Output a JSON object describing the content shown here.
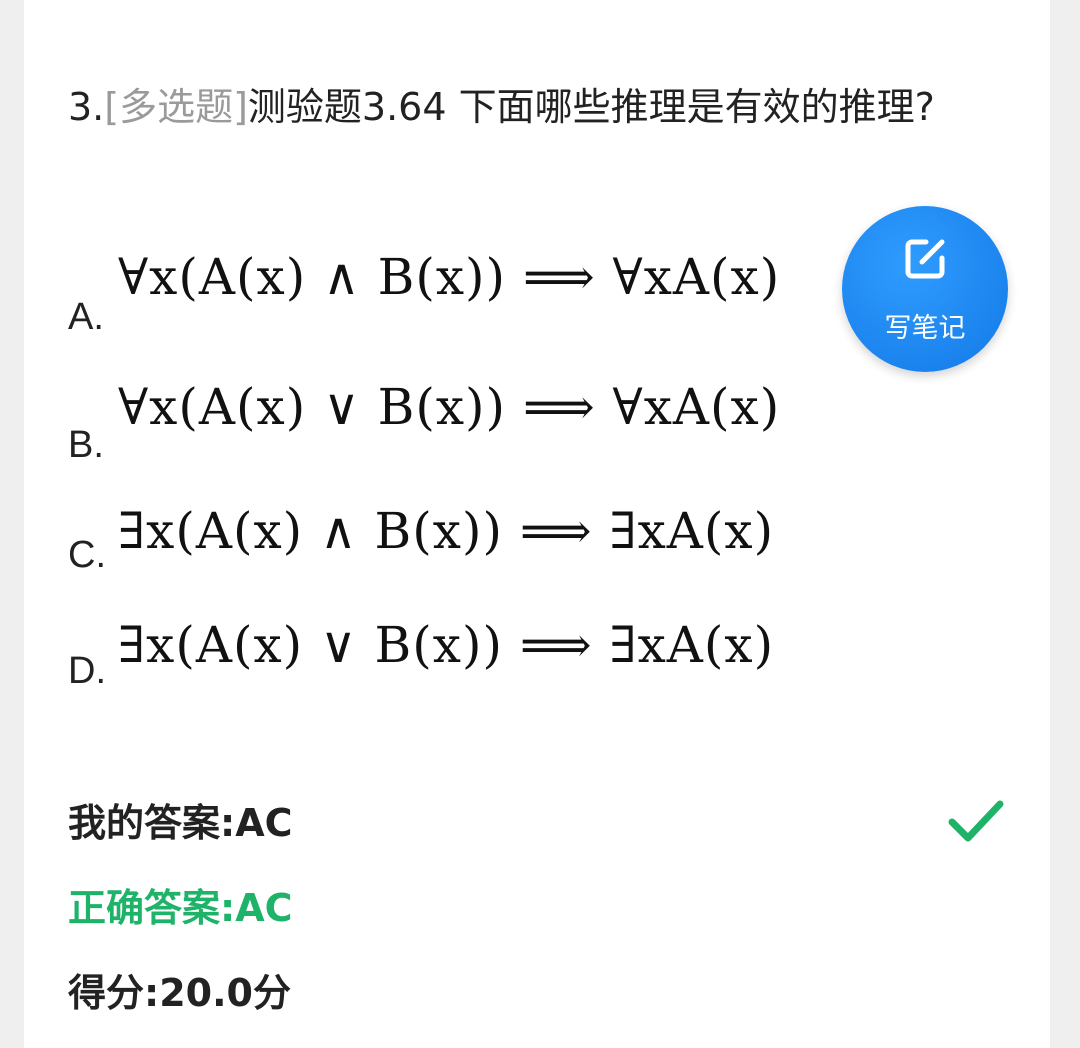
{
  "question": {
    "number": "3.",
    "type_tag": "[多选题]",
    "text": "测验题3.64 下面哪些推理是有效的推理?"
  },
  "options": [
    {
      "letter": "A.",
      "formula": "∀x(A(x) ∧ B(x)) ⟹ ∀xA(x)"
    },
    {
      "letter": "B.",
      "formula": "∀x(A(x) ∨ B(x)) ⟹ ∀xA(x)"
    },
    {
      "letter": "C.",
      "formula": "∃x(A(x) ∧ B(x)) ⟹ ∃xA(x)"
    },
    {
      "letter": "D.",
      "formula": "∃x(A(x) ∨ B(x)) ⟹ ∃xA(x)"
    }
  ],
  "note_button": {
    "label": "写笔记",
    "icon": "edit-note-icon",
    "color": "#1f86f0"
  },
  "result": {
    "my_answer": "我的答案:AC",
    "correct_answer": "正确答案:AC",
    "score": "得分:20.0分",
    "status_icon": "checkmark-icon",
    "correct_color": "#1fb36a"
  }
}
